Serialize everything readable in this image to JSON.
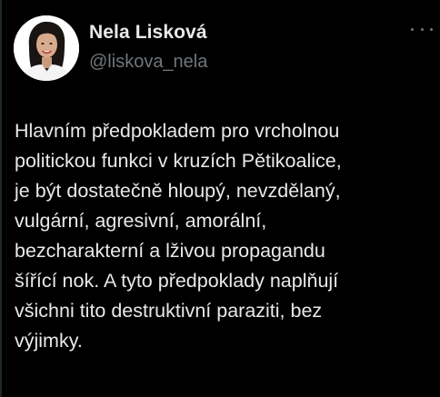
{
  "tweet": {
    "author": {
      "name": "Nela Lisková",
      "handle": "@liskova_nela"
    },
    "more_icon": "more-horizontal-icon",
    "text": "Hlavním předpokladem pro vrcholnou\npolitickou funkci v kruzích Pětikoalice,\nje být dostatečně hloupý, nevzdělaný,\nvulgární, agresivní, amorální,\nbezcharakterní a lživou propagandu\nšířící nok. A tyto předpoklady naplňují\nvšichni tito destruktivní paraziti, bez\nvýjimky."
  },
  "colors": {
    "background": "#000000",
    "primary_text": "#e7e9ea",
    "secondary_text": "#71767b"
  }
}
